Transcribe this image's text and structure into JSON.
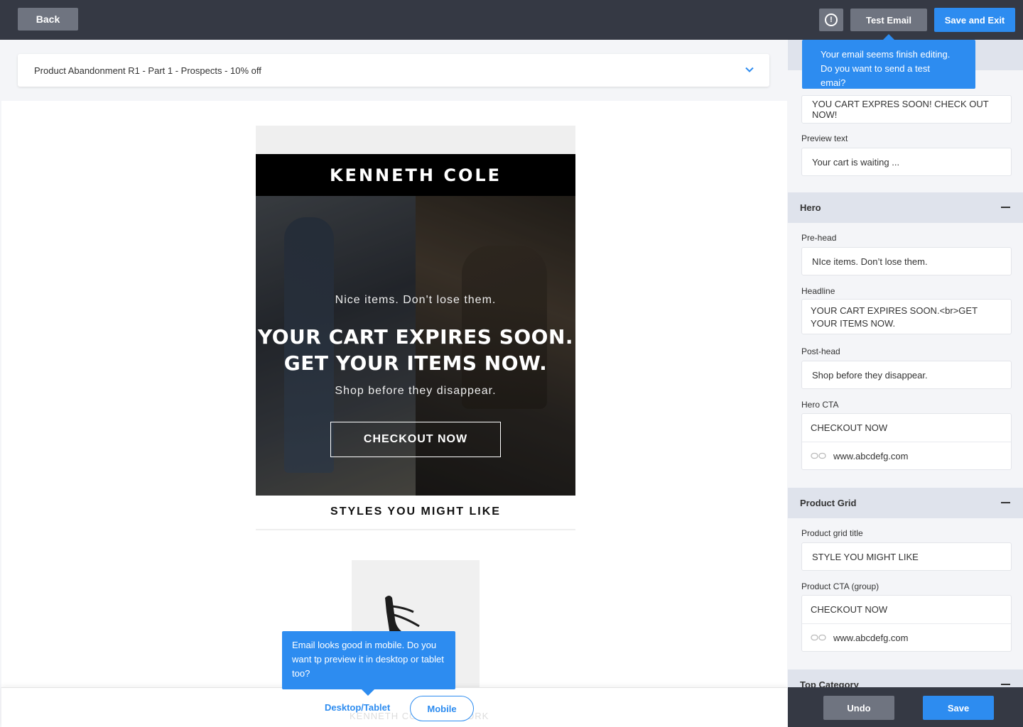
{
  "topbar": {
    "back_label": "Back",
    "info_icon": "info-circle-icon",
    "test_email_label": "Test Email",
    "save_exit_label": "Save and Exit"
  },
  "campaign": {
    "name": "Product Abandonment R1 - Part 1 - Prospects - 10% off",
    "chevron_icon": "chevron-down-icon"
  },
  "email": {
    "brand": "KENNETH COLE",
    "prehead": "Nice items. Don't lose them.",
    "headline_line1": "YOUR CART EXPIRES SOON.",
    "headline_line2": "GET YOUR ITEMS NOW.",
    "posthead": "Shop before they disappear.",
    "cta": "CHECKOUT NOW",
    "grid_title": "STYLES YOU MIGHT LIKE",
    "footer_ghost": "KENNETH COLE NEW YORK"
  },
  "tooltips": {
    "test_email": "Your email seems finish editing. Do you want to send a test emai?",
    "mobile": "Email looks good in mobile. Do you want tp preview it in desktop or tablet too?"
  },
  "preview_tabs": {
    "desktop": "Desktop/Tablet",
    "mobile": "Mobile"
  },
  "sidebar": {
    "subject_value": "YOU CART EXPRES SOON! CHECK OUT NOW!",
    "preview_label": "Preview text",
    "preview_value": "Your cart is waiting ...",
    "hero": {
      "title": "Hero",
      "prehead_label": "Pre-head",
      "prehead_value": "NIce items. Don’t lose them.",
      "headline_label": "Headline",
      "headline_value": "YOUR CART EXPIRES SOON.<br>GET YOUR ITEMS NOW.",
      "posthead_label": "Post-head",
      "posthead_value": "Shop before they disappear.",
      "cta_label": "Hero CTA",
      "cta_text": "CHECKOUT NOW",
      "cta_url": "www.abcdefg.com"
    },
    "product_grid": {
      "title": "Product Grid",
      "grid_title_label": "Product grid title",
      "grid_title_value": "STYLE YOU MIGHT LIKE",
      "cta_label": "Product CTA (group)",
      "cta_text": "CHECKOUT NOW",
      "cta_url": "www.abcdefg.com"
    },
    "top_category": {
      "title": "Top Category"
    }
  },
  "footer": {
    "undo_label": "Undo",
    "save_label": "Save"
  }
}
